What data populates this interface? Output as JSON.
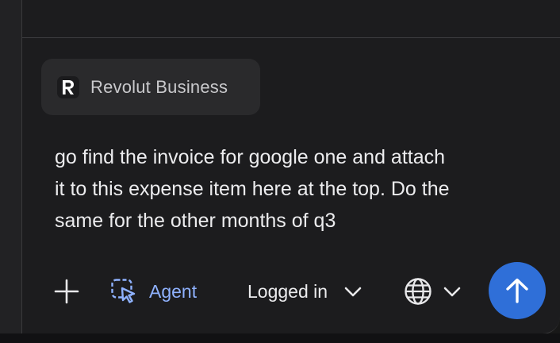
{
  "context_chip": {
    "label": "Revolut Business",
    "logo_letter": "R",
    "logo_icon": "revolut-logo-icon"
  },
  "prompt": {
    "text": "go find the invoice for google one and attach\nit to this expense item here at the top. Do the\nsame for the other months of q3"
  },
  "toolbar": {
    "add_icon": "plus-icon",
    "agent": {
      "label": "Agent",
      "icon": "agent-cursor-icon"
    },
    "session": {
      "label": "Logged in",
      "icon": "chevron-down-icon"
    },
    "language": {
      "icon": "globe-icon",
      "chevron_icon": "chevron-down-icon"
    },
    "send": {
      "icon": "arrow-up-icon"
    }
  },
  "colors": {
    "background": "#1c1c1e",
    "chip_background": "#2a2a2c",
    "accent_blue": "#2f6fd8",
    "agent_text": "#8fb2ff",
    "text_primary": "#ececee",
    "text_secondary": "#c9c9cc"
  }
}
